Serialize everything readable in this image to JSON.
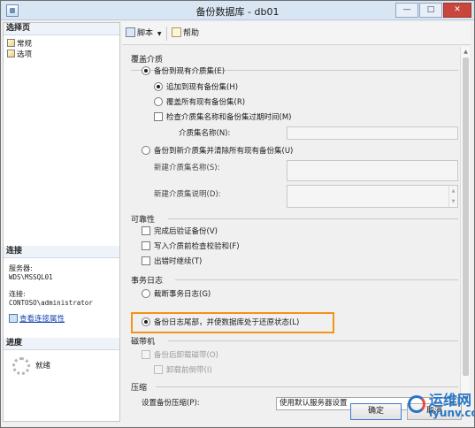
{
  "window": {
    "title": "备份数据库 - db01",
    "min": "—",
    "max": "□",
    "close": "✕"
  },
  "left": {
    "pages_header": "选择页",
    "pages": [
      "常规",
      "选项"
    ],
    "connection_header": "连接",
    "server_label": "服务器:",
    "server_value": "WDS\\MSSQL01",
    "conn_label": "连接:",
    "conn_value": "CONTOSO\\administrator",
    "view_conn_link": "查看连接属性",
    "progress_header": "进度",
    "progress_status": "就绪"
  },
  "toolbar": {
    "script_label": "脚本",
    "script_arrow": "▼",
    "help_label": "帮助"
  },
  "sections": {
    "overwrite": {
      "title": "覆盖介质",
      "backup_existing": "备份到现有介质集(E)",
      "append": "追加到现有备份集(H)",
      "overwrite_all": "覆盖所有现有备份集(R)",
      "check_expiry": "检查介质集名称和备份集过期时间(M)",
      "media_set_name_label": "介质集名称(N):",
      "backup_new": "备份到新介质集并清除所有现有备份集(U)",
      "new_media_name_label": "新建介质集名称(S):",
      "new_media_desc_label": "新建介质集说明(D):"
    },
    "reliability": {
      "title": "可靠性",
      "verify": "完成后验证备份(V)",
      "checksum": "写入介质前检查校验和(F)",
      "continue_on_error": "出错时继续(T)"
    },
    "transaction_log": {
      "title": "事务日志",
      "truncate": "截断事务日志(G)",
      "backup_tail": "备份日志尾部，并使数据库处于还原状态(L)"
    },
    "tape": {
      "title": "磁带机",
      "unload": "备份后卸载磁带(O)",
      "rewind": "卸载前倒带(I)"
    },
    "compression": {
      "title": "压缩",
      "label": "设置备份压缩(P):",
      "value": "使用默认服务器设置"
    }
  },
  "footer": {
    "ok": "确定",
    "cancel": "取消"
  },
  "watermark": {
    "cn": "运维网",
    "en": "iyunv.com"
  },
  "colors": {
    "highlight": "#f39319",
    "link": "#1545b0",
    "titlebar": "#d8e6f3"
  }
}
